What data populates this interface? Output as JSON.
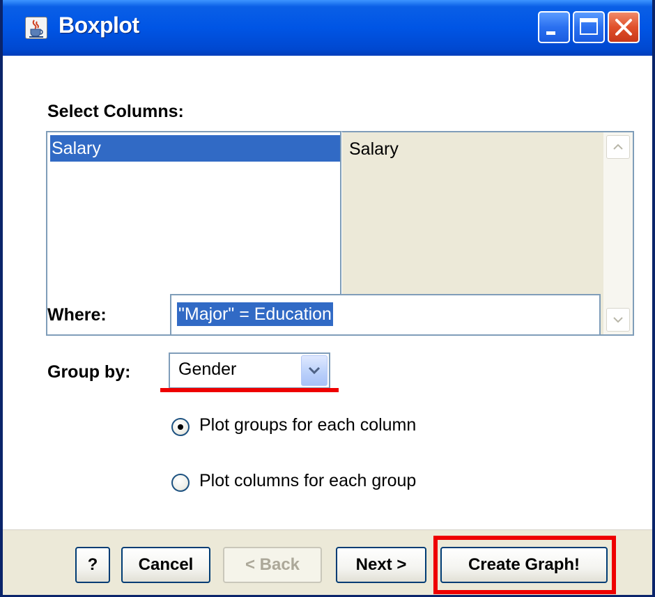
{
  "window": {
    "title": "Boxplot",
    "controls": {
      "minimize": "minimize",
      "maximize": "maximize",
      "close": "close"
    }
  },
  "select_columns": {
    "label": "Select Columns:",
    "list_items": [
      "Salary"
    ],
    "selected_item": "Salary",
    "selected_text": "Salary"
  },
  "where": {
    "label": "Where:",
    "value": "\"Major\" = Education"
  },
  "group_by": {
    "label": "Group by:",
    "value": "Gender"
  },
  "options": [
    {
      "label": "Plot groups for each column",
      "selected": true
    },
    {
      "label": "Plot columns for each group",
      "selected": false
    }
  ],
  "buttons": {
    "help": "?",
    "cancel": "Cancel",
    "back": "< Back",
    "next": "Next >",
    "create": "Create Graph!"
  },
  "colors": {
    "highlight_annotation": "#ee0000",
    "selection": "#316ac5",
    "titlebar": "#0055e5"
  },
  "icons": {
    "app": "java-cup-icon",
    "dropdown": "chevron-down-icon",
    "scroll_up": "scroll-up-icon",
    "scroll_down": "scroll-down-icon"
  }
}
